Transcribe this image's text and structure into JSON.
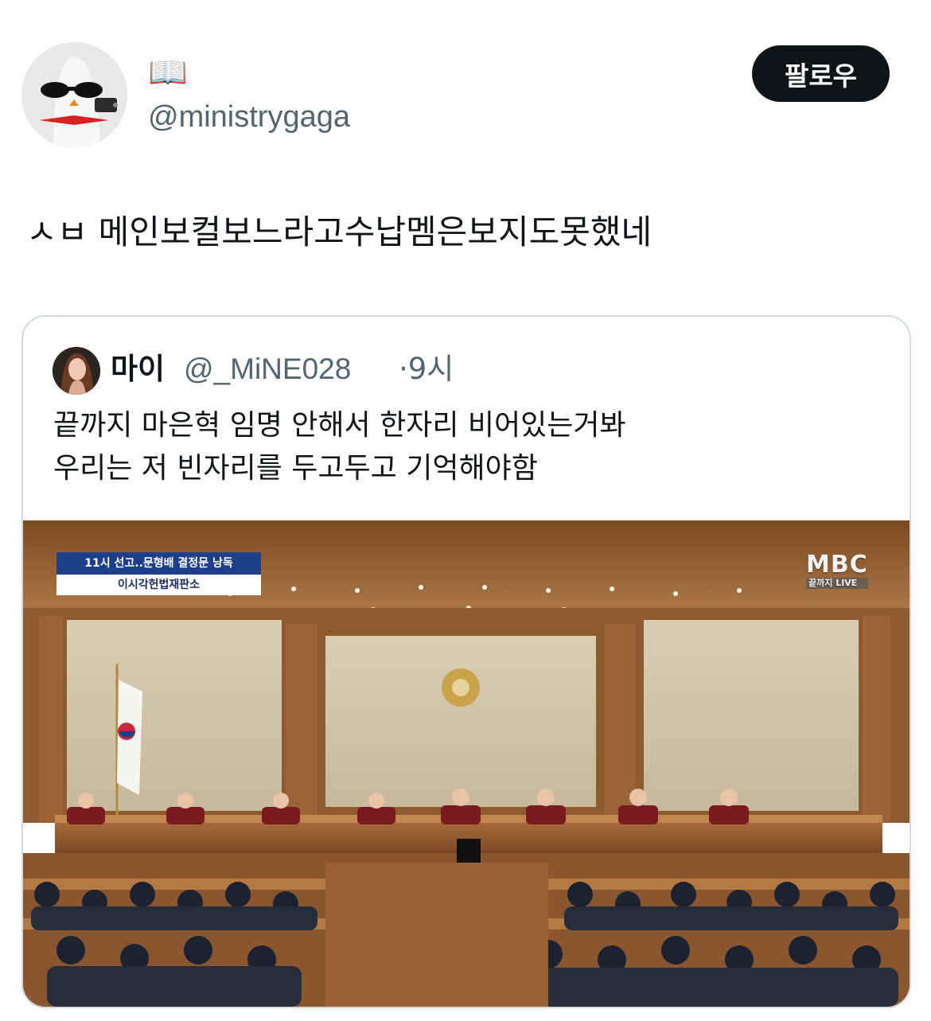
{
  "author": {
    "display_name": "📖",
    "handle": "@ministrygaga",
    "avatar_icon": "egg-sunglasses-avatar"
  },
  "follow_button": {
    "label": "팔로우"
  },
  "tweet": {
    "text": "ㅅㅂ 메인보컬보느라고수납멤은보지도못했네"
  },
  "quoted_tweet": {
    "name": "마이",
    "handle": "@_MiNE028",
    "time": "·9시",
    "text_line1": "끝까지 마은혁 임명 안해서 한자리 비어있는거봐",
    "text_line2": "우리는 저 빈자리를 두고두고 기억해야함",
    "media": {
      "caption_top": "11시 선고..문형배 결정문 낭독",
      "caption_bottom": "이시각헌법재판소",
      "broadcaster_logo": "MBC",
      "broadcaster_sub": "끝까지 LIVE"
    }
  },
  "colors": {
    "text_primary": "#0f1419",
    "text_secondary": "#536471",
    "border": "#cfd9de",
    "follow_bg": "#0f1419"
  }
}
